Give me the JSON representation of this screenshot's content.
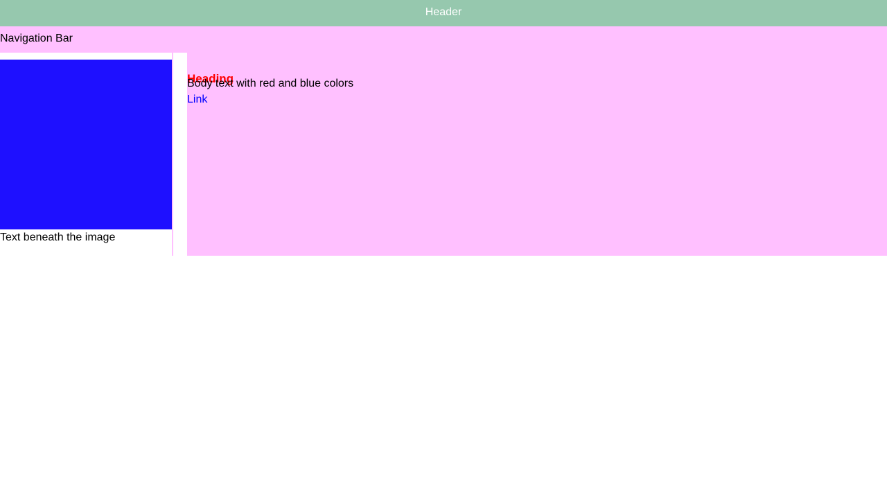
{
  "header": {
    "title": "Header"
  },
  "nav": {
    "label": "Navigation Bar"
  },
  "sidebar": {
    "caption": "Text beneath the image"
  },
  "main": {
    "heading": "Heading",
    "body": "Body text with red and blue colors",
    "link": "Link"
  },
  "colors": {
    "header_bg": "#96c8ae",
    "content_bg": "#ffc0ff",
    "image_fill": "#1e10ff",
    "heading": "#ff0000",
    "link": "#0000ff"
  }
}
